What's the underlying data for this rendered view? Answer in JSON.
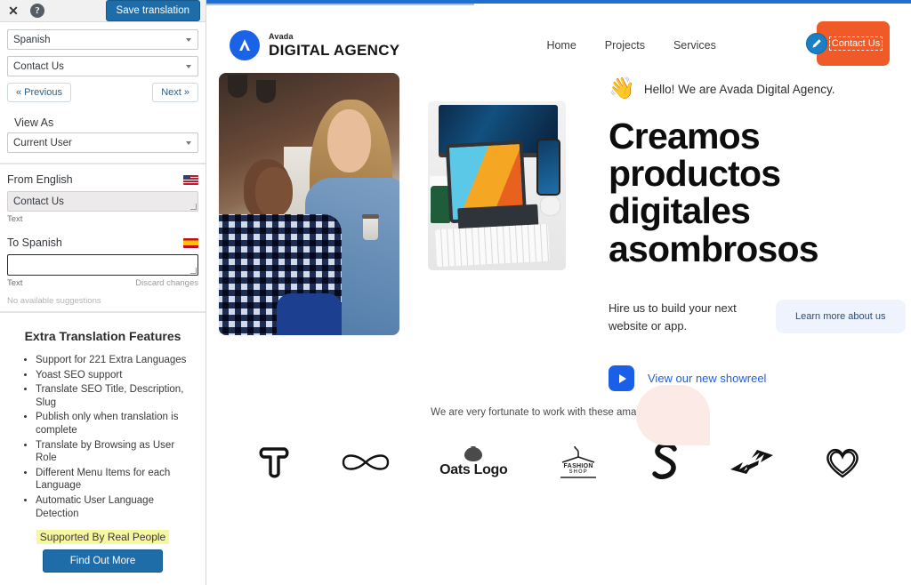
{
  "sidebar": {
    "toolbar": {
      "close_icon": "close-icon",
      "help_icon": "help-icon",
      "help_glyph": "?",
      "close_glyph": "✕",
      "save_label": "Save translation"
    },
    "language_select": {
      "value": "Spanish"
    },
    "string_select": {
      "value": "Contact Us"
    },
    "prev_label": "« Previous",
    "next_label": "Next »",
    "view_as_label": "View As",
    "view_as_select": {
      "value": "Current User"
    },
    "source": {
      "heading": "From English",
      "flag": "us-flag-icon",
      "value": "Contact Us",
      "type_label": "Text"
    },
    "target": {
      "heading": "To Spanish",
      "flag": "spain-flag-icon",
      "value": "",
      "placeholder": "",
      "type_label": "Text",
      "discard_label": "Discard changes",
      "suggestions": "No available suggestions"
    },
    "promo": {
      "title": "Extra Translation Features",
      "features": [
        "Support for 221 Extra Languages",
        "Yoast SEO support",
        "Translate SEO Title, Description, Slug",
        "Publish only when translation is complete",
        "Translate by Browsing as User Role",
        "Different Menu Items for each Language",
        "Automatic User Language Detection"
      ],
      "highlight": "Supported By Real People",
      "button_label": "Find Out More"
    }
  },
  "preview": {
    "header": {
      "logo_sub": "Avada",
      "logo_main": "DIGITAL AGENCY",
      "logo_icon": "avada-logo-icon",
      "nav": [
        {
          "label": "Home"
        },
        {
          "label": "Projects"
        },
        {
          "label": "Services"
        }
      ],
      "cta": {
        "label": "Contact Us",
        "edit_icon": "pencil-edit-icon",
        "color": "#f05a28"
      },
      "annotation_arrow": "red-arrow-annotation"
    },
    "hero": {
      "photo_alt": "two-colleagues-in-office-photo",
      "devices_alt": "tablet-keyboard-phone-photo",
      "blob": "pink-decorative-blob",
      "hello_emoji": "👋",
      "hello_text": "Hello! We are Avada Digital Agency.",
      "headline_lines": [
        "Creamos",
        "productos",
        "digitales",
        "asombrosos"
      ],
      "subtext": "Hire us to build your next website or app.",
      "learn_more_label": "Learn more about us",
      "showreel_label": "View our new showreel",
      "play_icon": "play-icon"
    },
    "partners": {
      "note": "We are very fortunate to work with these amazing partners",
      "logos": [
        {
          "name": "t-monogram-logo",
          "text": ""
        },
        {
          "name": "infinity-logo",
          "text": ""
        },
        {
          "name": "oats-logo",
          "text": "Oats Logo"
        },
        {
          "name": "fashion-shop-logo",
          "text": "FASHION",
          "text2": "SHOP"
        },
        {
          "name": "s-script-logo",
          "text": ""
        },
        {
          "name": "hands-logo",
          "text": ""
        },
        {
          "name": "heart-logo",
          "text": ""
        }
      ]
    }
  },
  "colors": {
    "accent_blue": "#1e6ca8",
    "cta_orange": "#f05a28",
    "link_blue": "#1a5fe8",
    "highlight_yellow": "#f7f7a0",
    "arrow_red": "#cc1111"
  }
}
